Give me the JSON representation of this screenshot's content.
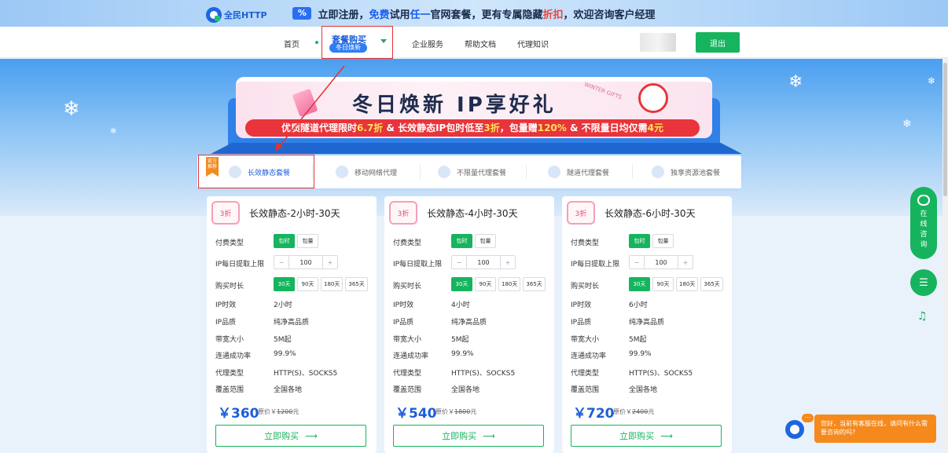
{
  "promo": {
    "icon": "%",
    "parts": [
      "立即注册，",
      "免费",
      "试用",
      "任一",
      "官网套餐，更有专属隐藏",
      "折扣",
      "，欢迎咨询客户经理"
    ]
  },
  "nav": {
    "logo_text": "全民HTTP",
    "home": "首页",
    "combo_title": "套餐购买",
    "combo_tag": "冬日焕新",
    "enterprise": "企业服务",
    "help": "帮助文档",
    "proxy_knowledge": "代理知识",
    "logout": "退出"
  },
  "banner": {
    "title": "冬日焕新  IP享好礼",
    "stamp": "WINTER GIFTS",
    "sub": [
      "优质隧道代理限时",
      "6.7折",
      " & 长效静态IP包时低至",
      "3折",
      "，包量赠",
      "120%",
      " & 不限量日均仅需",
      "4元"
    ]
  },
  "type_tabs": {
    "ribbon": "官方推荐",
    "items": [
      "长效静态套餐",
      "移动网络代理",
      "不限量代理套餐",
      "隧道代理套餐",
      "独享资源池套餐"
    ]
  },
  "labels": {
    "pay_type": "付费类型",
    "daily_limit": "IP每日提取上限",
    "duration": "购买时长",
    "ip_ttl": "IP时效",
    "ip_quality": "IP品质",
    "bandwidth": "带宽大小",
    "success_rate": "连通成功率",
    "proxy_type": "代理类型",
    "coverage": "覆盖范围",
    "orig_prefix": "原价￥",
    "orig_suffix": "元",
    "buy": "立即购买",
    "pay_options": [
      "包时",
      "包量"
    ],
    "durations": [
      "30天",
      "90天",
      "180天",
      "365天"
    ],
    "minus": "−",
    "plus": "+"
  },
  "cards": [
    {
      "badge": "3折",
      "title": "长效静态-2小时-30天",
      "daily_limit": "100",
      "ip_ttl": "2小时",
      "ip_quality": "纯净高品质",
      "bandwidth": "5M起",
      "success_rate": "99.9%",
      "proxy_type": "HTTP(S)、SOCKS5",
      "coverage": "全国各地",
      "price": "￥360",
      "orig": "1200"
    },
    {
      "badge": "3折",
      "title": "长效静态-4小时-30天",
      "daily_limit": "100",
      "ip_ttl": "4小时",
      "ip_quality": "纯净高品质",
      "bandwidth": "5M起",
      "success_rate": "99.9%",
      "proxy_type": "HTTP(S)、SOCKS5",
      "coverage": "全国各地",
      "price": "￥540",
      "orig": "1800"
    },
    {
      "badge": "3折",
      "title": "长效静态-6小时-30天",
      "daily_limit": "100",
      "ip_ttl": "6小时",
      "ip_quality": "纯净高品质",
      "bandwidth": "5M起",
      "success_rate": "99.9%",
      "proxy_type": "HTTP(S)、SOCKS5",
      "coverage": "全国各地",
      "price": "￥720",
      "orig": "2400"
    }
  ],
  "side": {
    "consult": [
      "在",
      "线",
      "咨",
      "询"
    ]
  },
  "chat": {
    "dots": "...",
    "message": "您好，当前有客服在线，请问有什么需要咨询的吗?"
  },
  "colors": {
    "brand_green": "#16b45e",
    "brand_blue": "#1d5ed8",
    "highlight_red": "#e03434",
    "chat_orange": "#f5891c"
  },
  "icons": [
    "percent-icon",
    "logo-icon",
    "chevron-down-icon",
    "snowflake-icon",
    "clock-icon",
    "mobile-icon",
    "gear-icon",
    "tunnel-icon",
    "pool-icon",
    "arrow-right-icon",
    "chat-bubble-icon",
    "sliders-icon",
    "bell-icon"
  ]
}
